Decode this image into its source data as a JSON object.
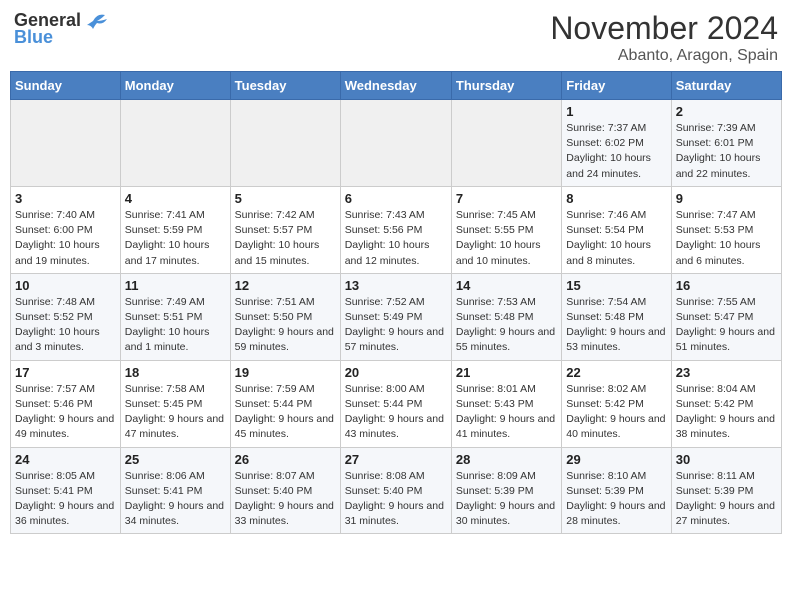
{
  "header": {
    "logo_general": "General",
    "logo_blue": "Blue",
    "month_title": "November 2024",
    "location": "Abanto, Aragon, Spain"
  },
  "days_of_week": [
    "Sunday",
    "Monday",
    "Tuesday",
    "Wednesday",
    "Thursday",
    "Friday",
    "Saturday"
  ],
  "weeks": [
    [
      {
        "day": "",
        "info": ""
      },
      {
        "day": "",
        "info": ""
      },
      {
        "day": "",
        "info": ""
      },
      {
        "day": "",
        "info": ""
      },
      {
        "day": "",
        "info": ""
      },
      {
        "day": "1",
        "info": "Sunrise: 7:37 AM\nSunset: 6:02 PM\nDaylight: 10 hours and 24 minutes."
      },
      {
        "day": "2",
        "info": "Sunrise: 7:39 AM\nSunset: 6:01 PM\nDaylight: 10 hours and 22 minutes."
      }
    ],
    [
      {
        "day": "3",
        "info": "Sunrise: 7:40 AM\nSunset: 6:00 PM\nDaylight: 10 hours and 19 minutes."
      },
      {
        "day": "4",
        "info": "Sunrise: 7:41 AM\nSunset: 5:59 PM\nDaylight: 10 hours and 17 minutes."
      },
      {
        "day": "5",
        "info": "Sunrise: 7:42 AM\nSunset: 5:57 PM\nDaylight: 10 hours and 15 minutes."
      },
      {
        "day": "6",
        "info": "Sunrise: 7:43 AM\nSunset: 5:56 PM\nDaylight: 10 hours and 12 minutes."
      },
      {
        "day": "7",
        "info": "Sunrise: 7:45 AM\nSunset: 5:55 PM\nDaylight: 10 hours and 10 minutes."
      },
      {
        "day": "8",
        "info": "Sunrise: 7:46 AM\nSunset: 5:54 PM\nDaylight: 10 hours and 8 minutes."
      },
      {
        "day": "9",
        "info": "Sunrise: 7:47 AM\nSunset: 5:53 PM\nDaylight: 10 hours and 6 minutes."
      }
    ],
    [
      {
        "day": "10",
        "info": "Sunrise: 7:48 AM\nSunset: 5:52 PM\nDaylight: 10 hours and 3 minutes."
      },
      {
        "day": "11",
        "info": "Sunrise: 7:49 AM\nSunset: 5:51 PM\nDaylight: 10 hours and 1 minute."
      },
      {
        "day": "12",
        "info": "Sunrise: 7:51 AM\nSunset: 5:50 PM\nDaylight: 9 hours and 59 minutes."
      },
      {
        "day": "13",
        "info": "Sunrise: 7:52 AM\nSunset: 5:49 PM\nDaylight: 9 hours and 57 minutes."
      },
      {
        "day": "14",
        "info": "Sunrise: 7:53 AM\nSunset: 5:48 PM\nDaylight: 9 hours and 55 minutes."
      },
      {
        "day": "15",
        "info": "Sunrise: 7:54 AM\nSunset: 5:48 PM\nDaylight: 9 hours and 53 minutes."
      },
      {
        "day": "16",
        "info": "Sunrise: 7:55 AM\nSunset: 5:47 PM\nDaylight: 9 hours and 51 minutes."
      }
    ],
    [
      {
        "day": "17",
        "info": "Sunrise: 7:57 AM\nSunset: 5:46 PM\nDaylight: 9 hours and 49 minutes."
      },
      {
        "day": "18",
        "info": "Sunrise: 7:58 AM\nSunset: 5:45 PM\nDaylight: 9 hours and 47 minutes."
      },
      {
        "day": "19",
        "info": "Sunrise: 7:59 AM\nSunset: 5:44 PM\nDaylight: 9 hours and 45 minutes."
      },
      {
        "day": "20",
        "info": "Sunrise: 8:00 AM\nSunset: 5:44 PM\nDaylight: 9 hours and 43 minutes."
      },
      {
        "day": "21",
        "info": "Sunrise: 8:01 AM\nSunset: 5:43 PM\nDaylight: 9 hours and 41 minutes."
      },
      {
        "day": "22",
        "info": "Sunrise: 8:02 AM\nSunset: 5:42 PM\nDaylight: 9 hours and 40 minutes."
      },
      {
        "day": "23",
        "info": "Sunrise: 8:04 AM\nSunset: 5:42 PM\nDaylight: 9 hours and 38 minutes."
      }
    ],
    [
      {
        "day": "24",
        "info": "Sunrise: 8:05 AM\nSunset: 5:41 PM\nDaylight: 9 hours and 36 minutes."
      },
      {
        "day": "25",
        "info": "Sunrise: 8:06 AM\nSunset: 5:41 PM\nDaylight: 9 hours and 34 minutes."
      },
      {
        "day": "26",
        "info": "Sunrise: 8:07 AM\nSunset: 5:40 PM\nDaylight: 9 hours and 33 minutes."
      },
      {
        "day": "27",
        "info": "Sunrise: 8:08 AM\nSunset: 5:40 PM\nDaylight: 9 hours and 31 minutes."
      },
      {
        "day": "28",
        "info": "Sunrise: 8:09 AM\nSunset: 5:39 PM\nDaylight: 9 hours and 30 minutes."
      },
      {
        "day": "29",
        "info": "Sunrise: 8:10 AM\nSunset: 5:39 PM\nDaylight: 9 hours and 28 minutes."
      },
      {
        "day": "30",
        "info": "Sunrise: 8:11 AM\nSunset: 5:39 PM\nDaylight: 9 hours and 27 minutes."
      }
    ]
  ]
}
